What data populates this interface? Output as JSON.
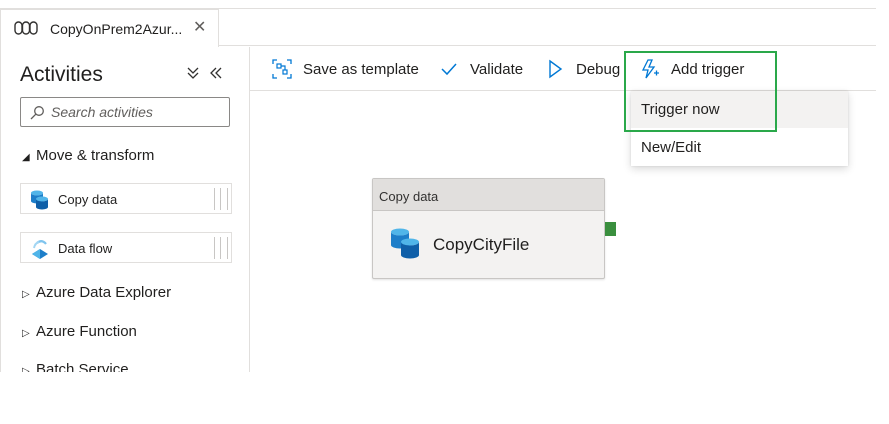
{
  "tab": {
    "title": "CopyOnPrem2Azur...",
    "close": "✕",
    "icon": "pipeline-icon"
  },
  "activities_pane": {
    "title": "Activities",
    "search_placeholder": "Search activities",
    "groups": {
      "move_transform": "Move & transform",
      "azure_data_explorer": "Azure Data Explorer",
      "azure_function": "Azure Function",
      "batch_service": "Batch Service"
    },
    "items": [
      {
        "label": "Copy data",
        "icon": "copy-data-icon"
      },
      {
        "label": "Data flow",
        "icon": "data-flow-icon"
      }
    ]
  },
  "toolbar": {
    "save_as_template": "Save as template",
    "validate": "Validate",
    "debug": "Debug",
    "add_trigger": "Add trigger"
  },
  "trigger_menu": {
    "items": [
      "Trigger now",
      "New/Edit"
    ],
    "hovered": "Trigger now"
  },
  "canvas": {
    "node": {
      "type": "Copy data",
      "name": "CopyCityFile"
    }
  },
  "colors": {
    "accent": "#0078d4",
    "highlight": "#2aa84a",
    "connector": "#3a8f3e"
  }
}
